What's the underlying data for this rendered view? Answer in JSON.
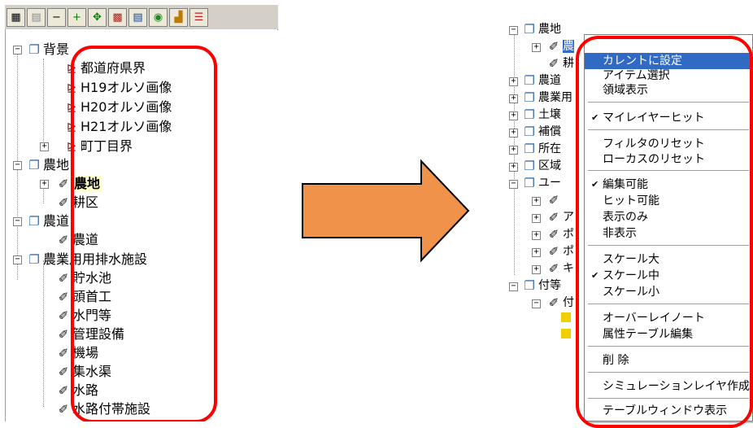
{
  "toolbar": {
    "buttons": [
      "add-layer-icon",
      "layer-copy-icon",
      "minus-icon",
      "plus-icon",
      "move-icon",
      "grid-delete-icon",
      "table-icon",
      "map-globe-icon",
      "chart-icon",
      "layers-icon"
    ],
    "glyphs": [
      "▦",
      "▤",
      "−",
      "+",
      "✥",
      "▩",
      "▤",
      "◉",
      "▟",
      "☰"
    ]
  },
  "left_tree": {
    "items": [
      {
        "label": "背景",
        "kind": "group",
        "depth": 0
      },
      {
        "label": "都道府県界",
        "kind": "image",
        "depth": 1
      },
      {
        "label": "H19オルソ画像",
        "kind": "image",
        "depth": 1
      },
      {
        "label": "H20オルソ画像",
        "kind": "image",
        "depth": 1
      },
      {
        "label": "H21オルソ画像",
        "kind": "image",
        "depth": 1
      },
      {
        "label": "町丁目界",
        "kind": "image",
        "depth": 1
      },
      {
        "label": "農地",
        "kind": "group",
        "depth": 0
      },
      {
        "label": "農地",
        "kind": "layer",
        "depth": 1,
        "highlight": true
      },
      {
        "label": "耕区",
        "kind": "layer",
        "depth": 1
      },
      {
        "label": "農道",
        "kind": "group",
        "depth": 0
      },
      {
        "label": "農道",
        "kind": "layer",
        "depth": 1
      },
      {
        "label": "農業用用排水施設",
        "kind": "group",
        "depth": 0
      },
      {
        "label": "貯水池",
        "kind": "layer",
        "depth": 1
      },
      {
        "label": "頭首工",
        "kind": "layer",
        "depth": 1
      },
      {
        "label": "水門等",
        "kind": "layer",
        "depth": 1
      },
      {
        "label": "管理設備",
        "kind": "layer",
        "depth": 1
      },
      {
        "label": "機場",
        "kind": "layer",
        "depth": 1
      },
      {
        "label": "集水渠",
        "kind": "layer",
        "depth": 1
      },
      {
        "label": "水路",
        "kind": "layer",
        "depth": 1
      },
      {
        "label": "水路付帯施設",
        "kind": "layer",
        "depth": 1
      }
    ]
  },
  "right_tree": {
    "items": [
      {
        "label": "農地"
      },
      {
        "label": "農"
      },
      {
        "label": "耕"
      },
      {
        "label": "農道"
      },
      {
        "label": "農業用"
      },
      {
        "label": "土壌"
      },
      {
        "label": "補償"
      },
      {
        "label": "所在"
      },
      {
        "label": "区域"
      },
      {
        "label": "ユー"
      },
      {
        "label": ""
      },
      {
        "label": "ア"
      },
      {
        "label": "ポ"
      },
      {
        "label": "ポ"
      },
      {
        "label": "キ"
      },
      {
        "label": "付等"
      },
      {
        "label": "付"
      }
    ]
  },
  "context_menu": {
    "items": [
      {
        "label": "カレントに設定",
        "selected": true
      },
      {
        "label": "アイテム選択"
      },
      {
        "label": "領域表示"
      },
      {
        "label": "マイレイヤーヒット",
        "checked": true
      },
      {
        "label": "フィルタのリセット"
      },
      {
        "label": "ローカスのリセット"
      },
      {
        "label": "編集可能",
        "checked": true
      },
      {
        "label": "ヒット可能"
      },
      {
        "label": "表示のみ"
      },
      {
        "label": "非表示"
      },
      {
        "label": "スケール大"
      },
      {
        "label": "スケール中",
        "checked": true
      },
      {
        "label": "スケール小"
      },
      {
        "label": "オーバーレイノート"
      },
      {
        "label": "属性テーブル編集"
      },
      {
        "label": "削 除"
      },
      {
        "label": "シミュレーションレイヤ作成"
      },
      {
        "label": "テーブルウィンドウ表示"
      }
    ]
  },
  "colors": {
    "highlight_box": "#ff0000",
    "arrow": "#f0924a",
    "menu_selection": "#316ac5"
  }
}
